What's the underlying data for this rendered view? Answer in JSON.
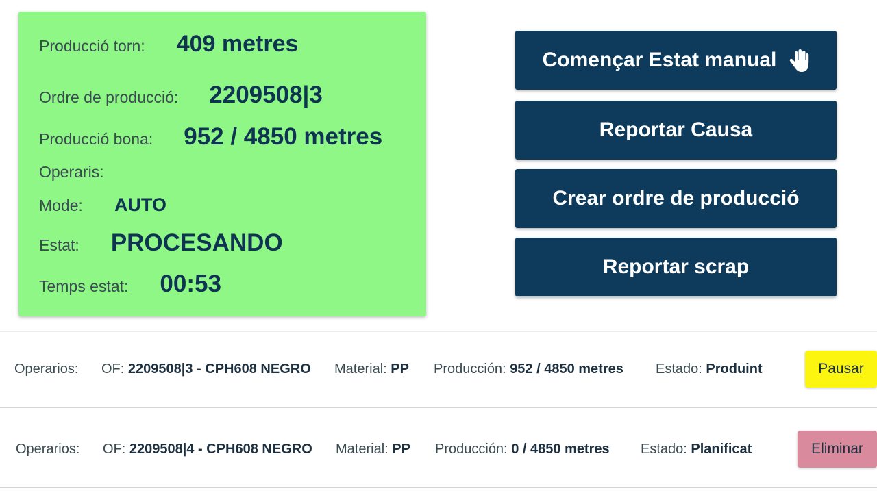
{
  "status": {
    "produccio_torn_label": "Producció torn:",
    "produccio_torn_value": "409 metres",
    "ordre_label": "Ordre de producció:",
    "ordre_value": "2209508|3",
    "bona_label": "Producció bona:",
    "bona_value": "952 / 4850 metres",
    "operaris_label": "Operaris:",
    "mode_label": "Mode:",
    "mode_value": "AUTO",
    "estat_label": "Estat:",
    "estat_value": "PROCESANDO",
    "temps_label": "Temps estat:",
    "temps_value": "00:53",
    "card_color": "#8ef786"
  },
  "actions": {
    "manual_label": "Començar Estat manual",
    "manual_icon": "hand-icon",
    "causa_label": "Reportar Causa",
    "crear_label": "Crear ordre de producció",
    "scrap_label": "Reportar scrap",
    "button_color": "#0e3a5b"
  },
  "orders": [
    {
      "operarios_label": "Operarios:",
      "of_label": "OF:",
      "of_value": "2209508|3 - CPH608 NEGRO",
      "material_label": "Material:",
      "material_value": "PP",
      "produccion_label": "Producción:",
      "produccion_value": "952 / 4850 metres",
      "estado_label": "Estado:",
      "estado_value": "Produint",
      "action_label": "Pausar",
      "action_color": "#fbf50f"
    },
    {
      "operarios_label": "Operarios:",
      "of_label": "OF:",
      "of_value": "2209508|4 - CPH608 NEGRO",
      "material_label": "Material:",
      "material_value": "PP",
      "produccion_label": "Producción:",
      "produccion_value": "0 / 4850 metres",
      "estado_label": "Estado:",
      "estado_value": "Planificat",
      "action_label": "Eliminar",
      "action_color": "#d98a9c"
    }
  ]
}
